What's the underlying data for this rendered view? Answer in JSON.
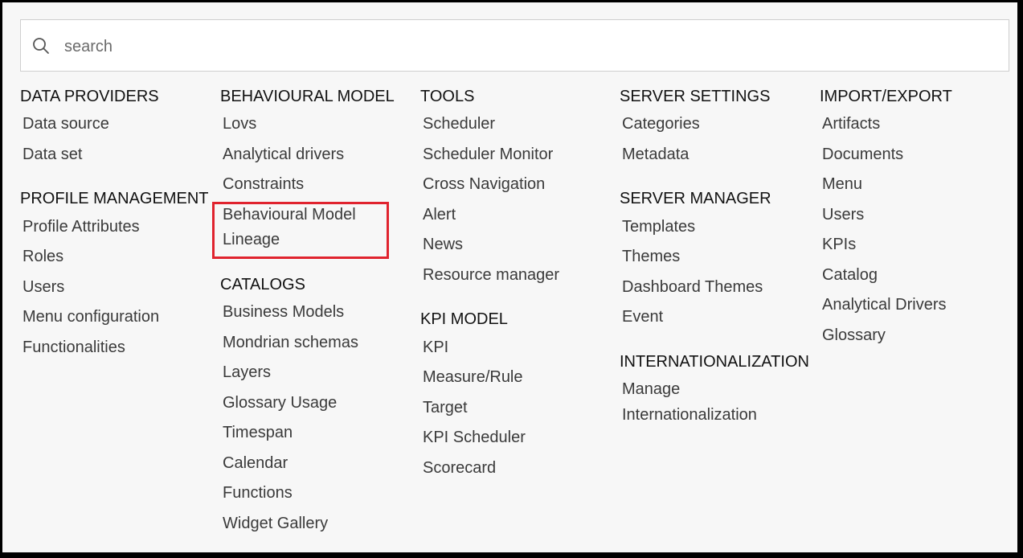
{
  "search": {
    "placeholder": "search"
  },
  "highlight_color": "#e0232e",
  "columns": [
    {
      "sections": [
        {
          "title": "DATA PROVIDERS",
          "items": [
            "Data source",
            "Data set"
          ]
        },
        {
          "title": "PROFILE MANAGEMENT",
          "items": [
            "Profile Attributes",
            "Roles",
            "Users",
            "Menu configuration",
            "Functionalities"
          ]
        }
      ]
    },
    {
      "sections": [
        {
          "title": "BEHAVIOURAL MODEL",
          "items": [
            "Lovs",
            "Analytical drivers",
            "Constraints",
            "Behavioural Model",
            "Lineage"
          ]
        },
        {
          "title": "CATALOGS",
          "items": [
            "Business Models",
            "Mondrian schemas",
            "Layers",
            "Glossary Usage",
            "Timespan",
            "Calendar",
            "Functions",
            "Widget Gallery"
          ]
        }
      ]
    },
    {
      "sections": [
        {
          "title": "TOOLS",
          "items": [
            "Scheduler",
            "Scheduler Monitor",
            "Cross Navigation",
            "Alert",
            "News",
            "Resource manager"
          ]
        },
        {
          "title": "KPI MODEL",
          "items": [
            "KPI",
            "Measure/Rule",
            "Target",
            "KPI Scheduler",
            "Scorecard"
          ]
        }
      ]
    },
    {
      "sections": [
        {
          "title": "SERVER SETTINGS",
          "items": [
            "Categories",
            "Metadata"
          ]
        },
        {
          "title": "SERVER MANAGER",
          "items": [
            "Templates",
            "Themes",
            "Dashboard Themes",
            "Event"
          ]
        },
        {
          "title": "INTERNATIONALIZATION",
          "items": [
            "Manage",
            "Internationalization"
          ]
        }
      ]
    },
    {
      "sections": [
        {
          "title": "IMPORT/EXPORT",
          "items": [
            "Artifacts",
            "Documents",
            "Menu",
            "Users",
            "KPIs",
            "Catalog",
            "Analytical Drivers",
            "Glossary"
          ]
        }
      ]
    }
  ]
}
